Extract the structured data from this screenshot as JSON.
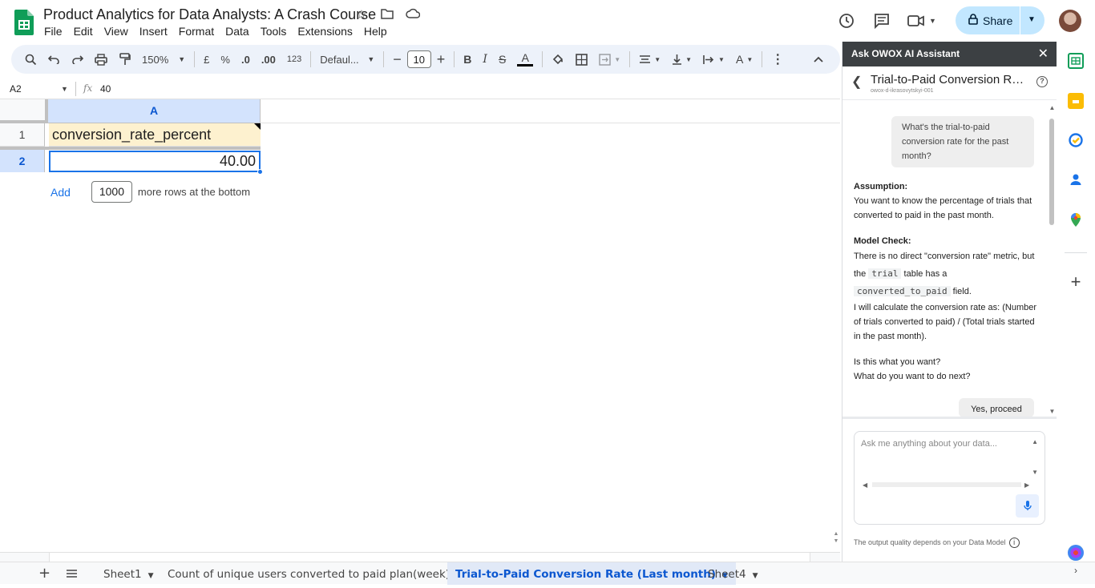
{
  "doc": {
    "title": "Product Analytics for Data Analysts: A Crash Course",
    "menu": [
      "File",
      "Edit",
      "View",
      "Insert",
      "Format",
      "Data",
      "Tools",
      "Extensions",
      "Help"
    ],
    "share_label": "Share"
  },
  "toolbar": {
    "zoom": "150%",
    "currency": "£",
    "percent": "%",
    "dec_dec": ".0",
    "dec_inc": ".00",
    "number_format": "123",
    "font": "Defaul...",
    "font_size": "10",
    "bold": "B",
    "italic": "I",
    "text_color_glyph": "A"
  },
  "formula_bar": {
    "cell_ref": "A2",
    "fx": "fx",
    "value": "40"
  },
  "grid": {
    "column_a": "A",
    "row1": "1",
    "row2": "2",
    "a1": "conversion_rate_percent",
    "a2": "40.00",
    "add_label": "Add",
    "add_count": "1000",
    "add_suffix": "more rows at the bottom"
  },
  "sheets": [
    {
      "name": "Sheet1",
      "active": false
    },
    {
      "name": "Count of unique users converted to paid plan(week)",
      "active": false
    },
    {
      "name": "Trial-to-Paid Conversion Rate (Last month)",
      "active": true
    },
    {
      "name": "Sheet4",
      "active": false
    }
  ],
  "assistant": {
    "header": "Ask OWOX AI Assistant",
    "title": "Trial-to-Paid Conversion Rate (Last month)",
    "user": "owox-d-ikrasovytskyi-001",
    "question": "What's the trial-to-paid conversion rate for the past month?",
    "assumption_title": "Assumption:",
    "assumption_text": "You want to know the percentage of trials that converted to paid in the past month.",
    "model_check_title": "Model Check:",
    "model_check_1": "There is no direct \"conversion rate\" metric, but the",
    "model_check_code1": "trial",
    "model_check_2": "table has a",
    "model_check_code2": "converted_to_paid",
    "model_check_3": "field.",
    "model_check_4": "I will calculate the conversion rate as: (Number of trials converted to paid) / (Total trials started in the past month).",
    "followup_1": "Is this what you want?",
    "followup_2": "What do you want to do next?",
    "yes_button": "Yes, proceed",
    "input_placeholder": "Ask me anything about your data...",
    "disclaimer": "The output quality depends on your Data Model"
  },
  "colors": {
    "selection": "#1a73e8",
    "header_selected": "#d3e3fd",
    "cell_highlight": "#fdf1cf",
    "share_bg": "#c2e7ff",
    "toolbar_bg": "#edf2fa",
    "panel_header": "#3c4043"
  }
}
